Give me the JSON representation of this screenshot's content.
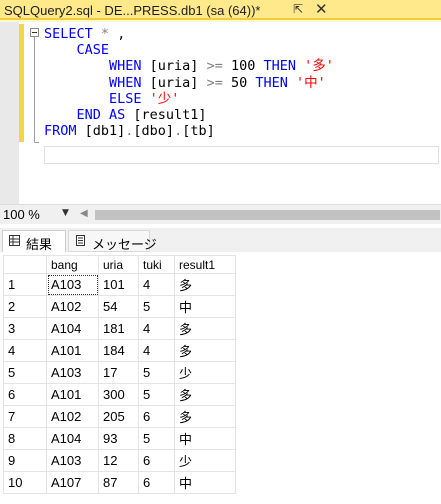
{
  "document_tab": {
    "title": "SQLQuery2.sql - DE...PRESS.db1 (sa (64))*",
    "pin_icon": "pin-icon",
    "close_icon": "close-icon"
  },
  "editor": {
    "lines": [
      [
        {
          "t": "SELECT",
          "c": "kw"
        },
        {
          "t": " ",
          "c": ""
        },
        {
          "t": "*",
          "c": "op"
        },
        {
          "t": " ,",
          "c": ""
        }
      ],
      [
        {
          "t": "    CASE",
          "c": "kw"
        }
      ],
      [
        {
          "t": "        WHEN ",
          "c": "kw"
        },
        {
          "t": "[uria] ",
          "c": ""
        },
        {
          "t": ">=",
          "c": "op"
        },
        {
          "t": " 100 ",
          "c": ""
        },
        {
          "t": "THEN ",
          "c": "kw"
        },
        {
          "t": "'多'",
          "c": "str"
        }
      ],
      [
        {
          "t": "        WHEN ",
          "c": "kw"
        },
        {
          "t": "[uria] ",
          "c": ""
        },
        {
          "t": ">=",
          "c": "op"
        },
        {
          "t": " 50 ",
          "c": ""
        },
        {
          "t": "THEN ",
          "c": "kw"
        },
        {
          "t": "'中'",
          "c": "str"
        }
      ],
      [
        {
          "t": "        ELSE ",
          "c": "kw"
        },
        {
          "t": "'少'",
          "c": "str"
        }
      ],
      [
        {
          "t": "    END AS ",
          "c": "kw"
        },
        {
          "t": "[result1]",
          "c": ""
        }
      ],
      [
        {
          "t": "FROM ",
          "c": "kw"
        },
        {
          "t": "[db1]",
          "c": ""
        },
        {
          "t": ".",
          "c": "op"
        },
        {
          "t": "[dbo]",
          "c": ""
        },
        {
          "t": ".",
          "c": "op"
        },
        {
          "t": "[tb]",
          "c": ""
        }
      ]
    ]
  },
  "zoom": {
    "value": "100 %"
  },
  "result_tabs": {
    "results": "結果",
    "messages": "メッセージ"
  },
  "grid": {
    "columns": [
      "",
      "bang",
      "uria",
      "tuki",
      "result1"
    ],
    "rows": [
      [
        "1",
        "A103",
        "101",
        "4",
        "多"
      ],
      [
        "2",
        "A102",
        "54",
        "5",
        "中"
      ],
      [
        "3",
        "A104",
        "181",
        "4",
        "多"
      ],
      [
        "4",
        "A101",
        "184",
        "4",
        "多"
      ],
      [
        "5",
        "A103",
        "17",
        "5",
        "少"
      ],
      [
        "6",
        "A101",
        "300",
        "5",
        "多"
      ],
      [
        "7",
        "A102",
        "205",
        "6",
        "多"
      ],
      [
        "8",
        "A104",
        "93",
        "5",
        "中"
      ],
      [
        "9",
        "A103",
        "12",
        "6",
        "少"
      ],
      [
        "10",
        "A107",
        "87",
        "6",
        "中"
      ]
    ]
  }
}
